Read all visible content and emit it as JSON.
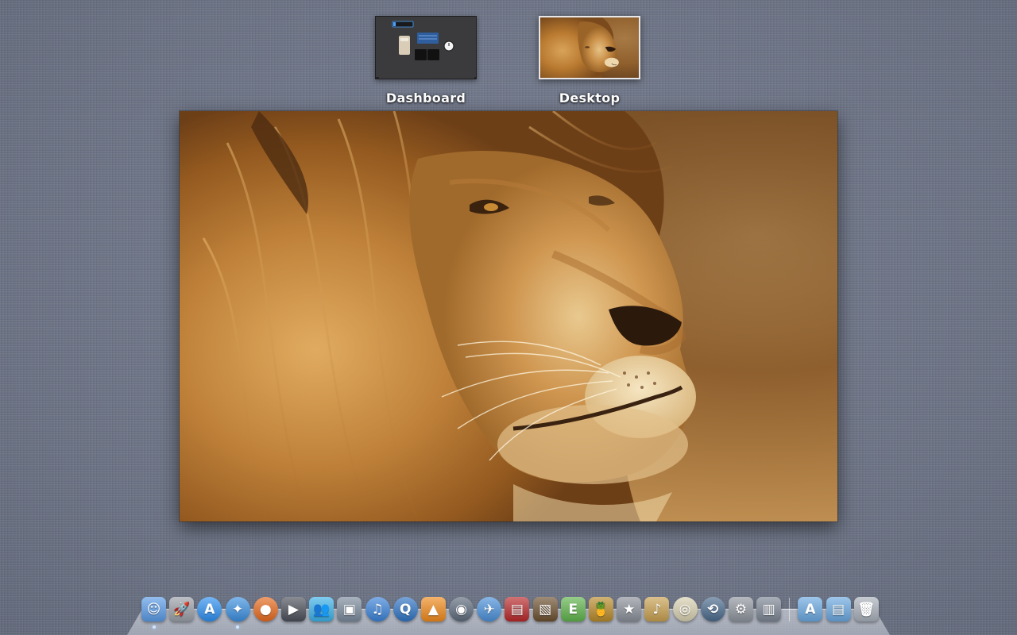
{
  "spaces": [
    {
      "label": "Dashboard",
      "kind": "dashboard"
    },
    {
      "label": "Desktop",
      "kind": "desktop",
      "selected": true
    }
  ],
  "wallpaper": {
    "subject": "lion",
    "palette": [
      "#b8742a",
      "#8a5520",
      "#e0b06a",
      "#f1d8a0"
    ]
  },
  "dock": {
    "apps": [
      {
        "name": "finder-icon",
        "glyph": "☺",
        "bg": "#5a9be6",
        "running": true
      },
      {
        "name": "launchpad-icon",
        "glyph": "🚀",
        "bg": "#9aa0a8"
      },
      {
        "name": "app-store-icon",
        "glyph": "A",
        "bg": "#2d8ff0",
        "round": true
      },
      {
        "name": "safari-icon",
        "glyph": "✦",
        "bg": "#3b8fe0",
        "round": true,
        "running": true
      },
      {
        "name": "firefox-icon",
        "glyph": "●",
        "bg": "#e66a1e",
        "round": true
      },
      {
        "name": "facetime-icon",
        "glyph": "▶",
        "bg": "#4b4f58"
      },
      {
        "name": "messenger-icon",
        "glyph": "👥",
        "bg": "#3bb1e8"
      },
      {
        "name": "photo-browser-icon",
        "glyph": "▣",
        "bg": "#7a8a9c"
      },
      {
        "name": "itunes-icon",
        "glyph": "♫",
        "bg": "#3a82d8",
        "round": true
      },
      {
        "name": "quicktime-icon",
        "glyph": "Q",
        "bg": "#2f74c4",
        "round": true
      },
      {
        "name": "vlc-icon",
        "glyph": "▲",
        "bg": "#f08a1c"
      },
      {
        "name": "media-player-icon",
        "glyph": "◉",
        "bg": "#5d6a7c",
        "round": true
      },
      {
        "name": "mail-icon",
        "glyph": "✈",
        "bg": "#4a90d9",
        "round": true
      },
      {
        "name": "photobooth-icon",
        "glyph": "▤",
        "bg": "#b8282a"
      },
      {
        "name": "iphoto-icon",
        "glyph": "▧",
        "bg": "#6c4f2e"
      },
      {
        "name": "evernote-icon",
        "glyph": "E",
        "bg": "#5fb34b"
      },
      {
        "name": "cocktail-icon",
        "glyph": "🍍",
        "bg": "#b88a2a"
      },
      {
        "name": "imovie-icon",
        "glyph": "★",
        "bg": "#8a8f98"
      },
      {
        "name": "garageband-icon",
        "glyph": "♪",
        "bg": "#c8a050"
      },
      {
        "name": "dvd-player-icon",
        "glyph": "◎",
        "bg": "#d8d0b0",
        "round": true
      },
      {
        "name": "time-machine-icon",
        "glyph": "⟲",
        "bg": "#4a6a8c",
        "round": true
      },
      {
        "name": "system-preferences-icon",
        "glyph": "⚙",
        "bg": "#8f959e"
      },
      {
        "name": "utility-icon",
        "glyph": "▥",
        "bg": "#7c8694"
      }
    ],
    "stacks": [
      {
        "name": "applications-folder-icon",
        "glyph": "A",
        "bg": "#6aa8e0"
      },
      {
        "name": "documents-folder-icon",
        "glyph": "▤",
        "bg": "#6aa8e0"
      },
      {
        "name": "trash-icon",
        "glyph": "🗑",
        "bg": "#a9b0ba"
      }
    ]
  }
}
